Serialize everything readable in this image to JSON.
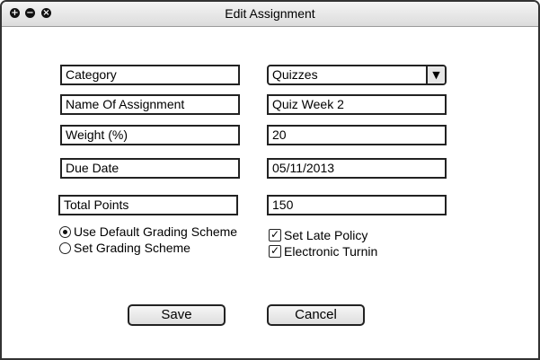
{
  "window": {
    "title": "Edit Assignment",
    "controls": {
      "add": "+",
      "minimize": "−",
      "close": "×"
    }
  },
  "form": {
    "category": {
      "label": "Category",
      "value": "Quizzes",
      "arrow": "▼"
    },
    "name": {
      "label": "Name Of Assignment",
      "value": "Quiz Week 2"
    },
    "weight": {
      "label": "Weight (%)",
      "value": "20"
    },
    "due_date": {
      "label": "Due Date",
      "value": "05/11/2013"
    },
    "total_points": {
      "label": "Total Points",
      "value": "150"
    },
    "grading": {
      "options": [
        {
          "label": "Use Default Grading Scheme",
          "checked": true
        },
        {
          "label": "Set Grading Scheme",
          "checked": false
        }
      ]
    },
    "flags": [
      {
        "label": "Set Late Policy",
        "checked": true,
        "mark": "✓"
      },
      {
        "label": "Electronic Turnin",
        "checked": true,
        "mark": "✓"
      }
    ]
  },
  "buttons": {
    "save": "Save",
    "cancel": "Cancel"
  }
}
